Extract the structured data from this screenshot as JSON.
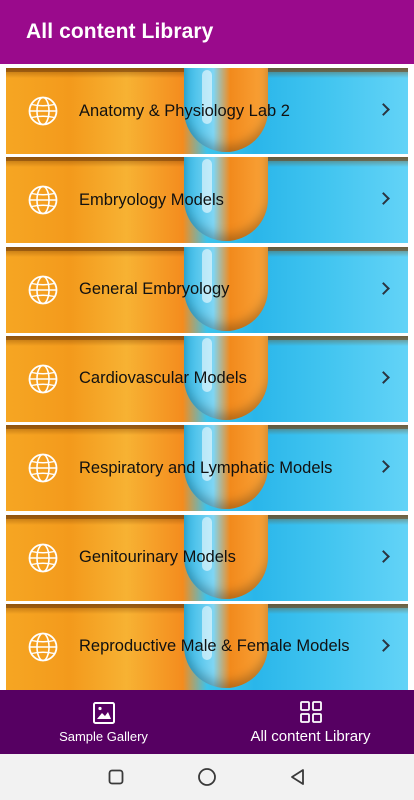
{
  "app_bar": {
    "title": "All content Library"
  },
  "colors": {
    "app_bar": "#9a0a8c",
    "bottom_nav": "#560062",
    "accent_orange": "#f39a1c",
    "accent_blue": "#2ab6ea"
  },
  "items": [
    {
      "label": "Anatomy & Physiology Lab 2",
      "icon": "globe-icon"
    },
    {
      "label": "Embryology Models",
      "icon": "globe-icon"
    },
    {
      "label": "General Embryology",
      "icon": "globe-icon"
    },
    {
      "label": "Cardiovascular Models",
      "icon": "globe-icon"
    },
    {
      "label": "Respiratory and Lymphatic Models",
      "icon": "globe-icon"
    },
    {
      "label": "Genitourinary Models",
      "icon": "globe-icon"
    },
    {
      "label": "Reproductive Male & Female Models",
      "icon": "globe-icon"
    }
  ],
  "bottom_nav": {
    "items": [
      {
        "label": "Sample Gallery",
        "icon": "image-icon"
      },
      {
        "label": "All content Library",
        "icon": "grid-icon",
        "active": true
      }
    ]
  },
  "system_nav": [
    "recents-icon",
    "home-icon",
    "back-icon"
  ]
}
